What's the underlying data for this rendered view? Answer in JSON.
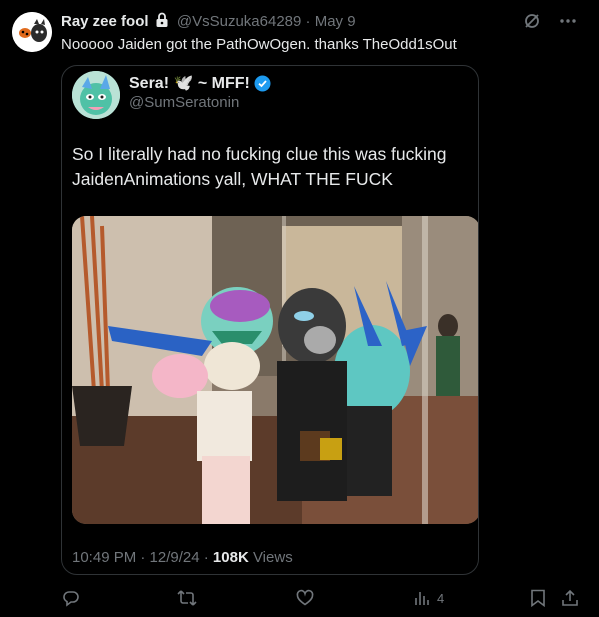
{
  "post": {
    "author_name": "Ray zee fool",
    "author_handle": "@VsSuzuka64289",
    "date": "· May 9",
    "text": "Nooooo Jaiden got the PathOwOgen. thanks TheOdd1sOut"
  },
  "quoted": {
    "name": "Sera! 🕊️ ~ MFF!",
    "handle": "@SumSeratonin",
    "text": "So I literally had no fucking clue this was fucking JaidenAnimations yall, WHAT THE FUCK",
    "meta_time": "10:49 PM · 12/9/24 · ",
    "views_count": "108K",
    "views_label": " Views"
  },
  "actions": {
    "analytics_count": "4"
  },
  "icons": {
    "lock": "lock-icon",
    "grok": "grok-icon",
    "more": "more-icon",
    "verified": "verified-badge-icon",
    "reply": "reply-icon",
    "retweet": "retweet-icon",
    "like": "like-icon",
    "analytics": "analytics-icon",
    "bookmark": "bookmark-icon",
    "share": "share-icon"
  },
  "colors": {
    "background": "#000000",
    "text": "#e7e9ea",
    "muted": "#71767b",
    "border": "#2f3336",
    "verified": "#1d9bf0"
  }
}
